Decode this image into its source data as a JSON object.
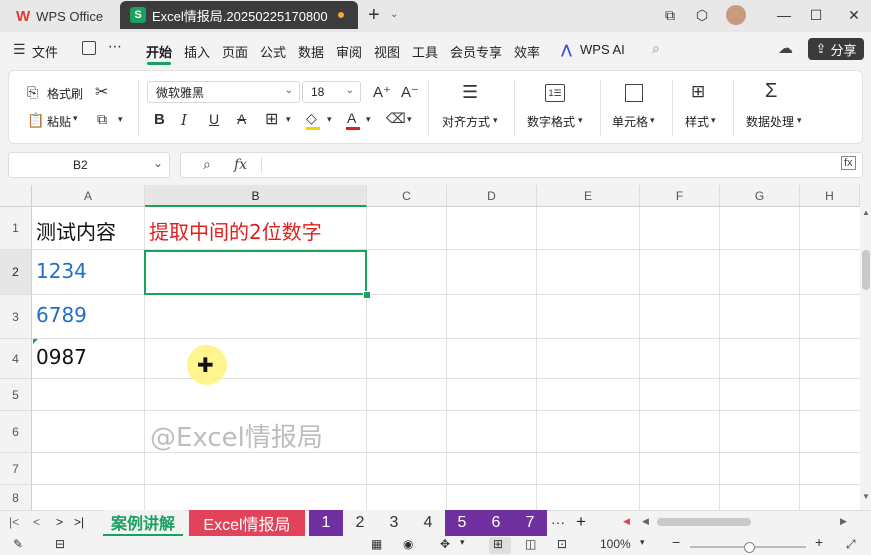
{
  "titlebar": {
    "app_name": "WPS Office",
    "doc_tab": "Excel情报局.20250225170800",
    "new_tab": "+",
    "window_controls": [
      "⧉",
      "⬡",
      "—",
      "☐",
      "✕"
    ]
  },
  "menubar": {
    "file": "文件",
    "items": [
      "开始",
      "插入",
      "页面",
      "公式",
      "数据",
      "审阅",
      "视图",
      "工具",
      "会员专享",
      "效率"
    ],
    "wps_ai": "WPS AI",
    "share": "分享"
  },
  "ribbon": {
    "format_painter": "格式刷",
    "paste": "粘贴",
    "font_name": "微软雅黑",
    "font_size": "18",
    "align": "对齐方式",
    "number_format": "数字格式",
    "cell": "单元格",
    "style": "样式",
    "data_process": "数据处理"
  },
  "formula_bar": {
    "name_box": "B2",
    "fx": "fx",
    "content": ""
  },
  "grid": {
    "columns": [
      "A",
      "B",
      "C",
      "D",
      "E",
      "F",
      "G",
      "H"
    ],
    "rows": [
      "1",
      "2",
      "3",
      "4",
      "5",
      "6",
      "7",
      "8"
    ],
    "cells": {
      "A1": "测试内容",
      "B1": "提取中间的2位数字",
      "A2": "1234",
      "A3": "6789",
      "A4": "0987"
    },
    "watermark": "@Excel情报局",
    "colors": {
      "a1": "#111111",
      "b1": "#e02020",
      "a2": "#1f6fc5",
      "a3": "#1f6fc5",
      "a4": "#111111",
      "selection": "#1aa160"
    }
  },
  "sheets": {
    "tabs": [
      {
        "label": "案例讲解",
        "bg": "#f3f3f3",
        "fg": "#1aa160"
      },
      {
        "label": "Excel情报局",
        "bg": "#e0435a",
        "fg": "#ffffff"
      },
      {
        "label": "1",
        "bg": "#7030a0",
        "fg": "#ffffff"
      },
      {
        "label": "2",
        "bg": "#f3f3f3",
        "fg": "#333333"
      },
      {
        "label": "3",
        "bg": "#f3f3f3",
        "fg": "#333333"
      },
      {
        "label": "4",
        "bg": "#f3f3f3",
        "fg": "#333333"
      },
      {
        "label": "5",
        "bg": "#7030a0",
        "fg": "#ffffff"
      },
      {
        "label": "6",
        "bg": "#7030a0",
        "fg": "#ffffff"
      },
      {
        "label": "7",
        "bg": "#7030a0",
        "fg": "#ffffff"
      }
    ],
    "more": "···",
    "add": "+"
  },
  "statusbar": {
    "zoom": "100%"
  }
}
